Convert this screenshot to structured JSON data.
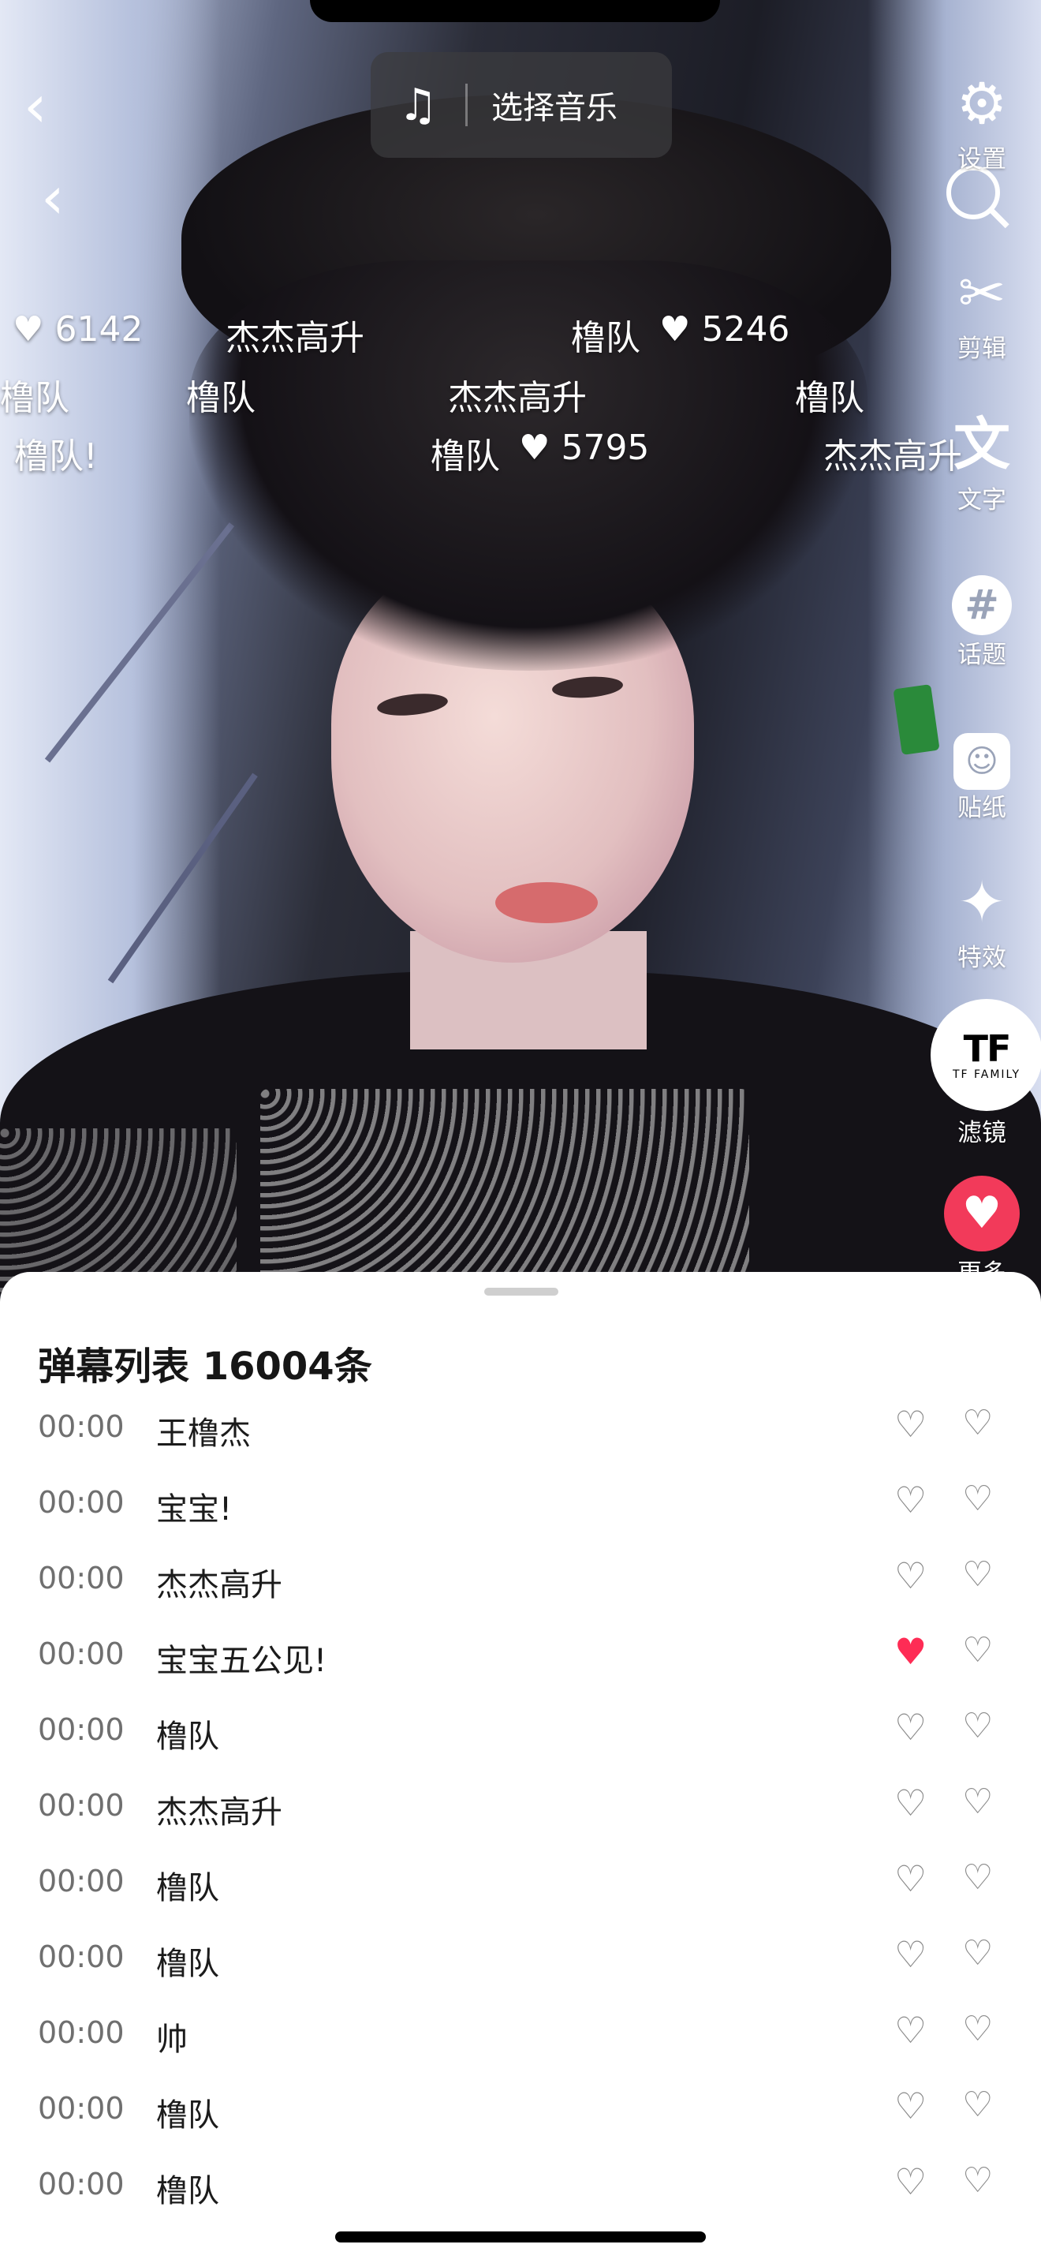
{
  "top": {
    "music_label": "选择音乐",
    "music_icon": "music-ai-icon"
  },
  "tools": [
    {
      "label": "设置",
      "icon": "gear-icon"
    },
    {
      "label": "剪辑",
      "icon": "scissors-icon"
    },
    {
      "label": "文字",
      "icon": "text-icon"
    },
    {
      "label": "话题",
      "icon": "hashtag-icon"
    },
    {
      "label": "贴纸",
      "icon": "sticker-icon"
    },
    {
      "label": "特效",
      "icon": "sparkle-icon"
    },
    {
      "label": "滤镜",
      "icon": "filter-icon",
      "logo": "TF",
      "logo_sub": "TF FAMILY"
    },
    {
      "label": "更多",
      "icon": "more-icon"
    }
  ],
  "danmu": [
    {
      "text": "6142",
      "heart": true
    },
    {
      "text": "杰杰高升"
    },
    {
      "text": "橹队"
    },
    {
      "text": "5246",
      "heart": true
    },
    {
      "text": "橹队"
    },
    {
      "text": "橹队"
    },
    {
      "text": "杰杰高升"
    },
    {
      "text": "橹队"
    },
    {
      "text": "橹队!"
    },
    {
      "text": "橹队"
    },
    {
      "text": "5795",
      "heart": true
    },
    {
      "text": "杰杰高升"
    }
  ],
  "sheet": {
    "title": "弹幕列表 16004条",
    "rows": [
      {
        "time": "00:00",
        "text": "王橹杰",
        "liked": false
      },
      {
        "time": "00:00",
        "text": "宝宝!",
        "liked": false
      },
      {
        "time": "00:00",
        "text": "杰杰高升",
        "liked": false
      },
      {
        "time": "00:00",
        "text": "宝宝五公见!",
        "liked": true
      },
      {
        "time": "00:00",
        "text": "橹队",
        "liked": false
      },
      {
        "time": "00:00",
        "text": "杰杰高升",
        "liked": false
      },
      {
        "time": "00:00",
        "text": "橹队",
        "liked": false
      },
      {
        "time": "00:00",
        "text": "橹队",
        "liked": false
      },
      {
        "time": "00:00",
        "text": "帅",
        "liked": false
      },
      {
        "time": "00:00",
        "text": "橹队",
        "liked": false
      },
      {
        "time": "00:00",
        "text": "橹队",
        "liked": false
      }
    ]
  },
  "colors": {
    "accent": "#fe2c55",
    "sheet_bg": "#ffffff"
  }
}
